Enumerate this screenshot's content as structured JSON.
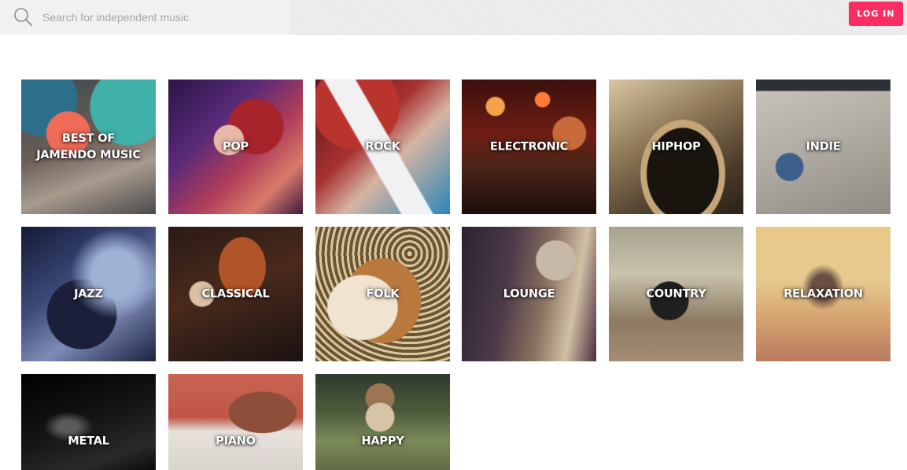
{
  "header": {
    "search": {
      "placeholder": "Search for independent music",
      "icon": "search-icon"
    },
    "login_label": "LOG IN",
    "login_color": "#fb2d63"
  },
  "genres": [
    {
      "label": "BEST OF\nJAMENDO MUSIC"
    },
    {
      "label": "POP"
    },
    {
      "label": "ROCK"
    },
    {
      "label": "ELECTRONIC"
    },
    {
      "label": "HIPHOP"
    },
    {
      "label": "INDIE"
    },
    {
      "label": "JAZZ"
    },
    {
      "label": "CLASSICAL"
    },
    {
      "label": "FOLK"
    },
    {
      "label": "LOUNGE"
    },
    {
      "label": "COUNTRY"
    },
    {
      "label": "RELAXATION"
    },
    {
      "label": "METAL"
    },
    {
      "label": "PIANO"
    },
    {
      "label": "HAPPY"
    }
  ]
}
